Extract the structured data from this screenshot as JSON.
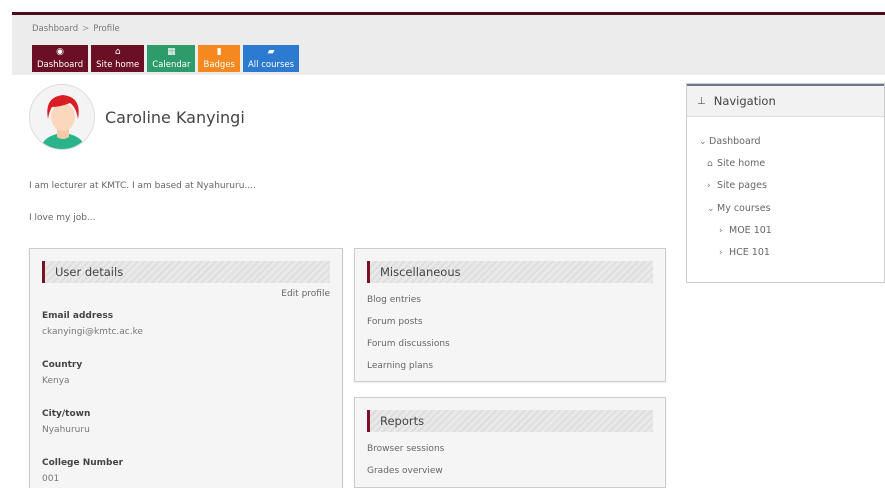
{
  "breadcrumb": {
    "items": [
      "Dashboard",
      "Profile"
    ],
    "separator": ">"
  },
  "quicklinks": [
    {
      "label": "Dashboard",
      "icon": "dashboard-icon",
      "color": "#6b0f24"
    },
    {
      "label": "Site home",
      "icon": "home-icon",
      "color": "#6b0f24"
    },
    {
      "label": "Calendar",
      "icon": "calendar-icon",
      "color": "#2e9b6b"
    },
    {
      "label": "Badges",
      "icon": "bookmark-icon",
      "color": "#f5891f"
    },
    {
      "label": "All courses",
      "icon": "book-icon",
      "color": "#2d7bd1"
    }
  ],
  "profile": {
    "name": "Caroline Kanyingi",
    "description": [
      "I am lecturer at KMTC. I am based at Nyahururu....",
      "I love my job..."
    ]
  },
  "user_details": {
    "title": "User details",
    "edit_label": "Edit profile",
    "fields": [
      {
        "label": "Email address",
        "value": "ckanyingi@kmtc.ac.ke"
      },
      {
        "label": "Country",
        "value": "Kenya"
      },
      {
        "label": "City/town",
        "value": "Nyahururu"
      },
      {
        "label": "College Number",
        "value": "001"
      }
    ]
  },
  "miscellaneous": {
    "title": "Miscellaneous",
    "links": [
      "Blog entries",
      "Forum posts",
      "Forum discussions",
      "Learning plans"
    ]
  },
  "reports": {
    "title": "Reports",
    "links": [
      "Browser sessions",
      "Grades overview"
    ]
  },
  "navigation": {
    "title": "Navigation",
    "items": [
      {
        "label": "Dashboard",
        "chevron": "down"
      },
      {
        "label": "Site home",
        "icon": "home-icon"
      },
      {
        "label": "Site pages",
        "chevron": "right"
      },
      {
        "label": "My courses",
        "chevron": "down"
      },
      {
        "label": "MOE 101",
        "chevron": "right"
      },
      {
        "label": "HCE 101",
        "chevron": "right"
      }
    ]
  },
  "colors": {
    "brand": "#6b0f24",
    "accent_green": "#2e9b6b",
    "accent_orange": "#f5891f",
    "accent_blue": "#2d7bd1"
  }
}
